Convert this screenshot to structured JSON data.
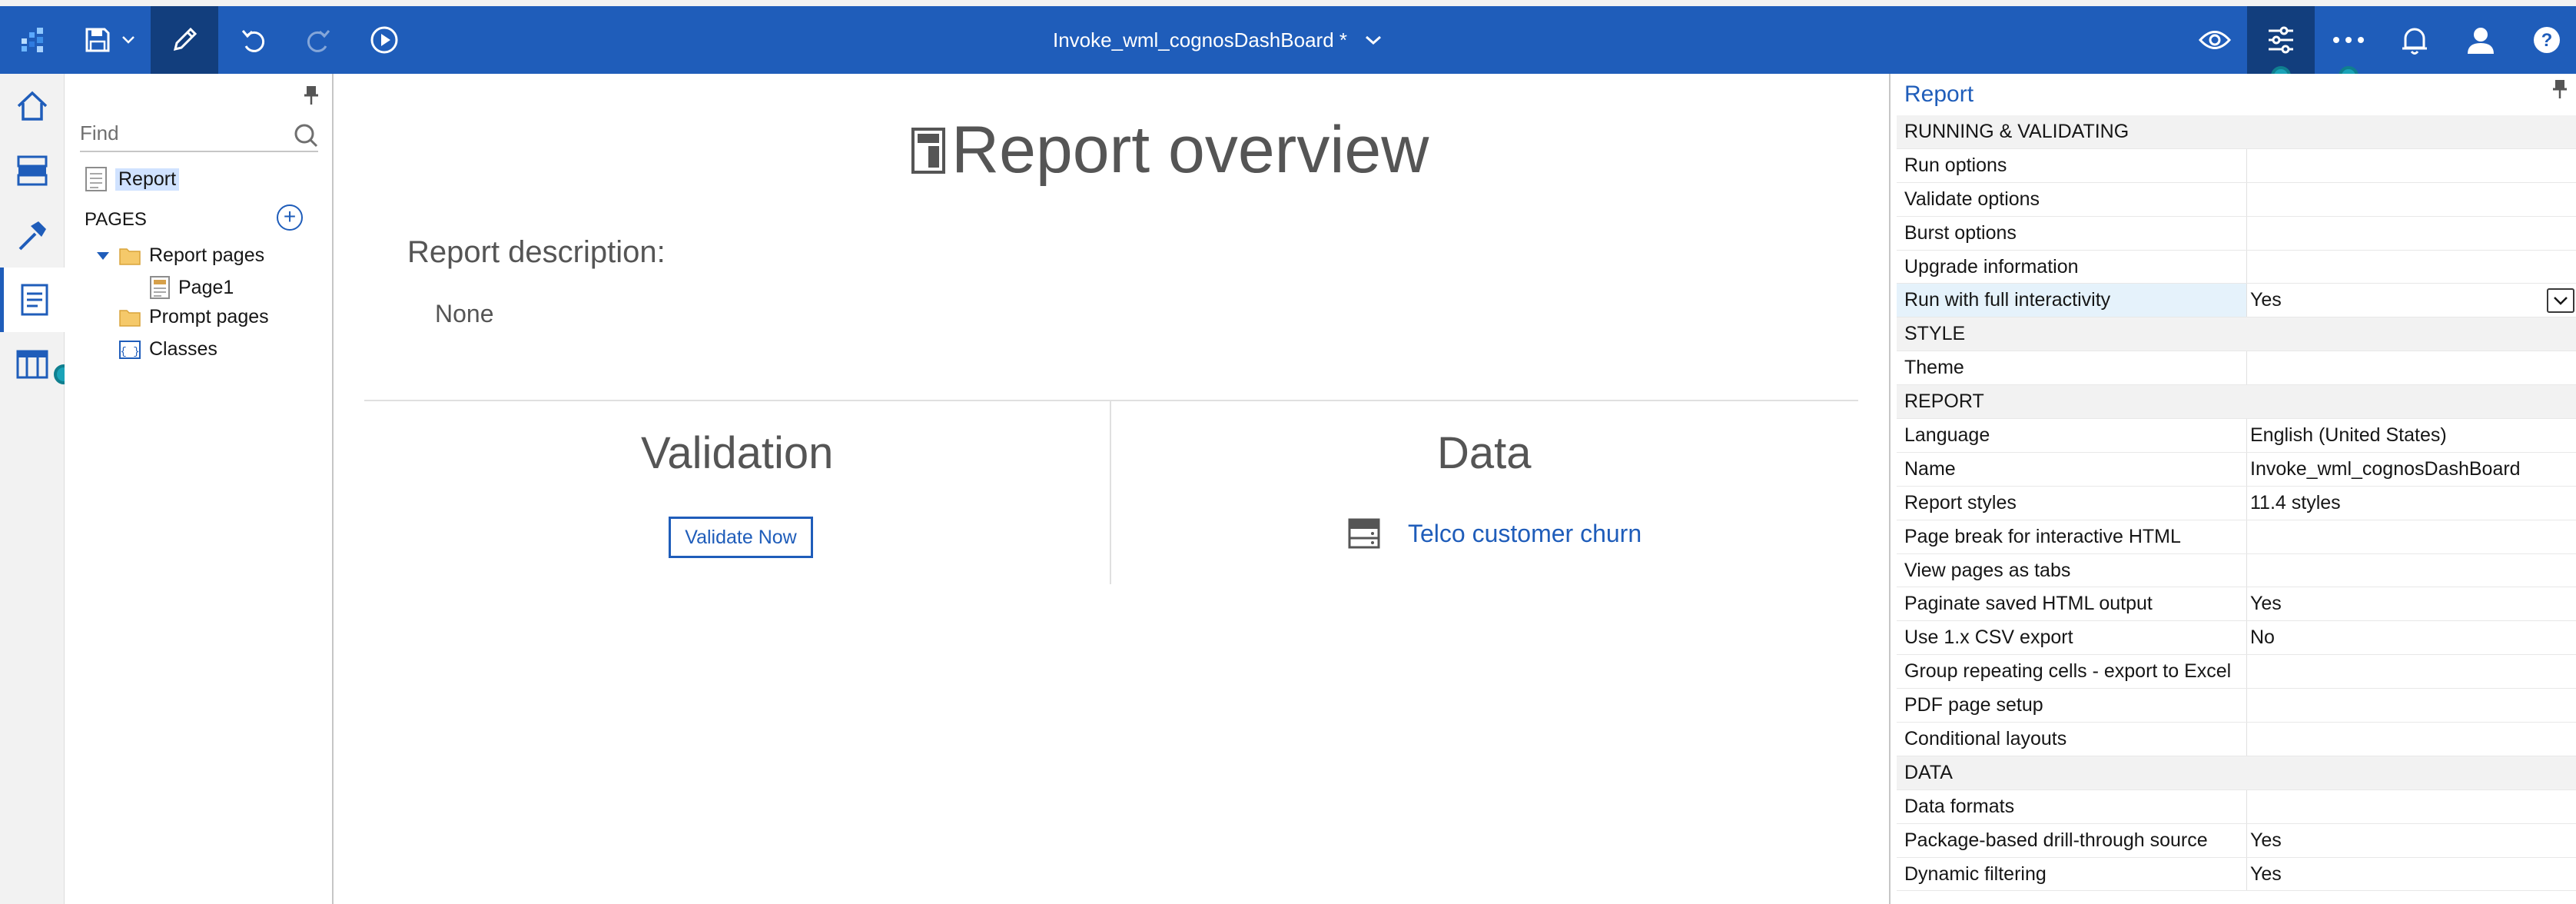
{
  "window": {
    "title": "Invoke_wml_cognosDashBoard *"
  },
  "toolbar": {
    "icons": [
      "app-switcher-icon",
      "save-icon",
      "chevron-down-icon",
      "edit-pencil-icon",
      "undo-icon",
      "redo-icon",
      "run-play-icon",
      "preview-eye-icon",
      "properties-sliders-icon",
      "more-ellipsis-icon",
      "notification-bell-icon",
      "user-avatar-icon",
      "help-icon"
    ]
  },
  "rail": {
    "items": [
      "home-icon",
      "data-source-icon",
      "toolbox-icon",
      "pages-icon",
      "columns-icon"
    ]
  },
  "tree": {
    "find_placeholder": "Find",
    "root": "Report",
    "pages_label": "PAGES",
    "add_symbol": "+",
    "report_pages": "Report pages",
    "page1": "Page1",
    "prompt_pages": "Prompt pages",
    "classes": "Classes"
  },
  "overview": {
    "title": "Report overview",
    "description_label": "Report description:",
    "description_value": "None",
    "validation_title": "Validation",
    "validate_button": "Validate Now",
    "data_title": "Data",
    "data_source": "Telco customer churn"
  },
  "properties": {
    "title": "Report",
    "rows": [
      {
        "label": "RUNNING & VALIDATING",
        "value": "",
        "section": true
      },
      {
        "label": "Run options",
        "value": ""
      },
      {
        "label": "Validate options",
        "value": ""
      },
      {
        "label": "Burst options",
        "value": ""
      },
      {
        "label": "Upgrade information",
        "value": ""
      },
      {
        "label": "Run with full interactivity",
        "value": "Yes",
        "highlight": true,
        "dropdown": true
      },
      {
        "label": "STYLE",
        "value": "",
        "section": true
      },
      {
        "label": "Theme",
        "value": ""
      },
      {
        "label": "REPORT",
        "value": "",
        "section": true
      },
      {
        "label": "Language",
        "value": "English (United States)"
      },
      {
        "label": "Name",
        "value": "Invoke_wml_cognosDashBoard"
      },
      {
        "label": "Report styles",
        "value": "11.4 styles"
      },
      {
        "label": "Page break for interactive HTML",
        "value": ""
      },
      {
        "label": "View pages as tabs",
        "value": ""
      },
      {
        "label": "Paginate saved HTML output",
        "value": "Yes"
      },
      {
        "label": "Use 1.x CSV export",
        "value": "No"
      },
      {
        "label": "Group repeating cells - export to Excel",
        "value": ""
      },
      {
        "label": "PDF page setup",
        "value": ""
      },
      {
        "label": "Conditional layouts",
        "value": ""
      },
      {
        "label": "DATA",
        "value": "",
        "section": true
      },
      {
        "label": "Data formats",
        "value": ""
      },
      {
        "label": "Package-based drill-through source",
        "value": "Yes"
      },
      {
        "label": "Dynamic filtering",
        "value": "Yes"
      }
    ]
  },
  "colors": {
    "brand": "#1f5dba",
    "active": "#123e7d",
    "accent_dot": "#1aa3b8"
  }
}
